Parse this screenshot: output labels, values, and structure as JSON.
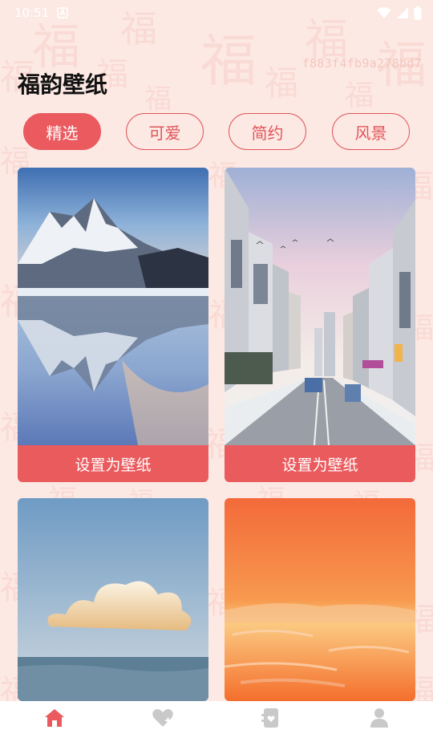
{
  "status_bar": {
    "time": "10:51"
  },
  "header": {
    "hash": "f883f4fb9a278bd7",
    "title": "福韵壁纸"
  },
  "tabs": [
    {
      "label": "精选",
      "active": true
    },
    {
      "label": "可爱",
      "active": false
    },
    {
      "label": "简约",
      "active": false
    },
    {
      "label": "风景",
      "active": false
    }
  ],
  "wallpapers": [
    {
      "subject": "snowy mountain lake",
      "button_label": "设置为壁纸"
    },
    {
      "subject": "city street",
      "button_label": "设置为壁纸"
    },
    {
      "subject": "cloud over sea",
      "button_label": ""
    },
    {
      "subject": "orange sunset sea",
      "button_label": ""
    }
  ],
  "bottom_nav": [
    {
      "icon": "home-icon",
      "active": true
    },
    {
      "icon": "heart-icon",
      "active": false
    },
    {
      "icon": "card-icon",
      "active": false
    },
    {
      "icon": "user-icon",
      "active": false
    }
  ],
  "colors": {
    "accent": "#ea5a5e",
    "background": "#fde9e4",
    "nav_inactive": "#c9c9c9"
  }
}
